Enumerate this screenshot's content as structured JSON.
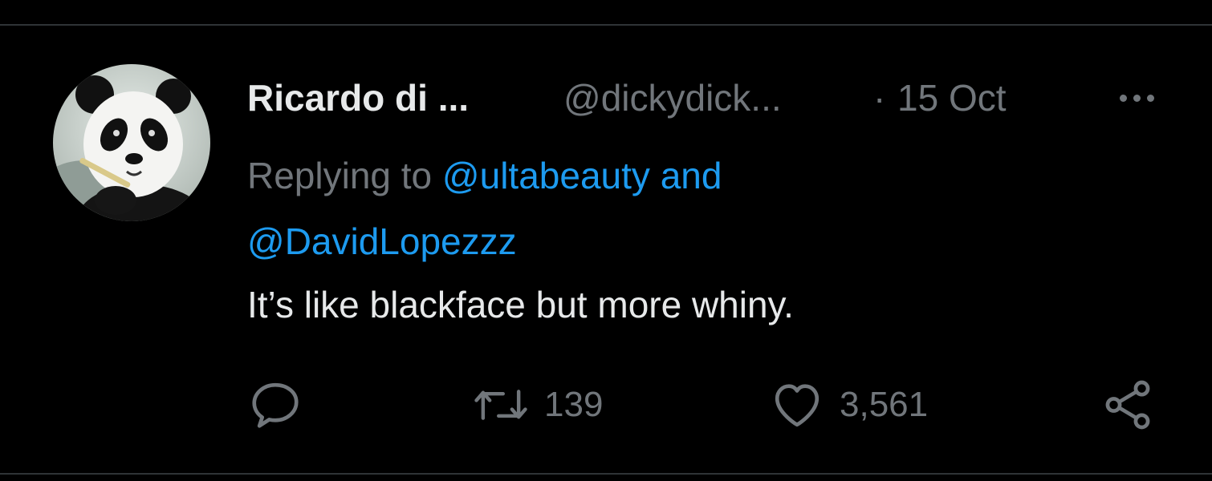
{
  "tweet": {
    "display_name": "Ricardo di ...",
    "handle": "@dickydick...",
    "separator": "·",
    "date": "15 Oct",
    "replying_prefix": "Replying to",
    "mention_1": "@ultabeauty",
    "mention_join": "and",
    "mention_2": "@DavidLopezzz",
    "text": "It’s like blackface but more whiny.",
    "avatar_icon": "panda-avatar",
    "more_icon": "more-horizontal-icon"
  },
  "actions": {
    "reply": {
      "icon": "reply-icon",
      "count": ""
    },
    "retweet": {
      "icon": "retweet-icon",
      "count": "139"
    },
    "like": {
      "icon": "heart-icon",
      "count": "3,561"
    },
    "share": {
      "icon": "share-icon"
    }
  },
  "colors": {
    "background": "#000000",
    "primary_text": "#e7e9ea",
    "secondary_text": "#71767b",
    "accent": "#1d9bf0",
    "divider": "#2f3336"
  }
}
